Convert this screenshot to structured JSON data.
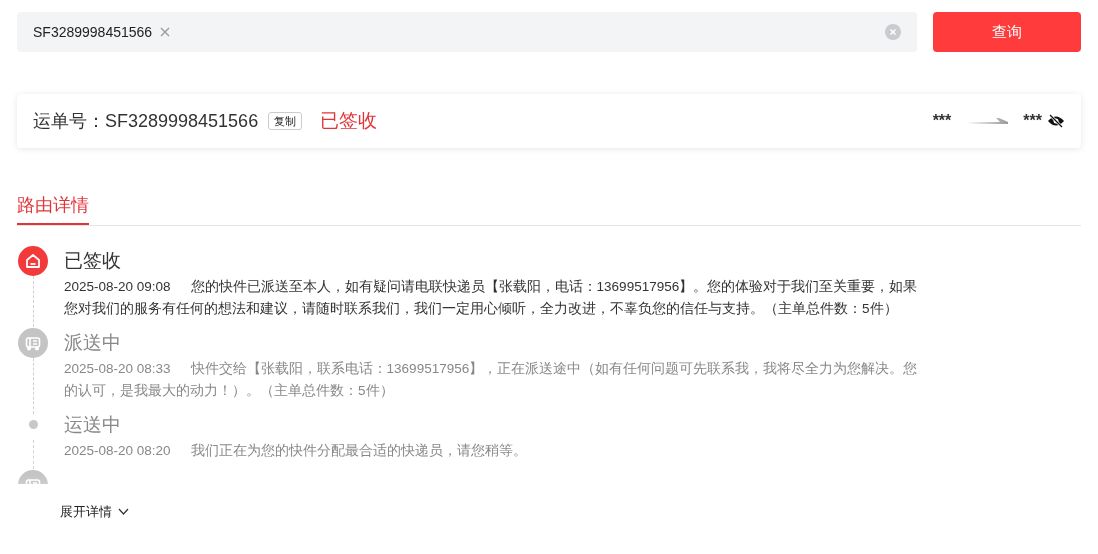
{
  "search": {
    "tag": "SF3289998451566",
    "button": "查询"
  },
  "waybill": {
    "label": "运单号：SF3289998451566",
    "copy": "复制",
    "status": "已签收",
    "from": "***",
    "to": "***"
  },
  "tabs": [
    {
      "label": "路由详情",
      "selected": true
    }
  ],
  "timeline": [
    {
      "kind": "delivered",
      "active": true,
      "title": "已签收",
      "time": "2025-08-20 09:08",
      "text": "您的快件已派送至本人，如有疑问请电联快递员【张载阳，电话：13699517956】。您的体验对于我们至关重要，如果您对我们的服务有任何的想法和建议，请随时联系我们，我们一定用心倾听，全力改进，不辜负您的信任与支持。（主单总件数：5件）"
    },
    {
      "kind": "dispatch",
      "active": false,
      "title": "派送中",
      "time": "2025-08-20 08:33",
      "text": "快件交给【张载阳，联系电话：13699517956】，正在派送途中（如有任何问题可先联系我，我将尽全力为您解决。您的认可，是我最大的动力！）。（主单总件数：5件）"
    },
    {
      "kind": "transit",
      "active": false,
      "title": "运送中",
      "time": "2025-08-20 08:20",
      "text": "我们正在为您的快件分配最合适的快递员，请您稍等。"
    },
    {
      "kind": "dispatch",
      "active": false,
      "clipped": true
    }
  ],
  "expand": "展开详情"
}
